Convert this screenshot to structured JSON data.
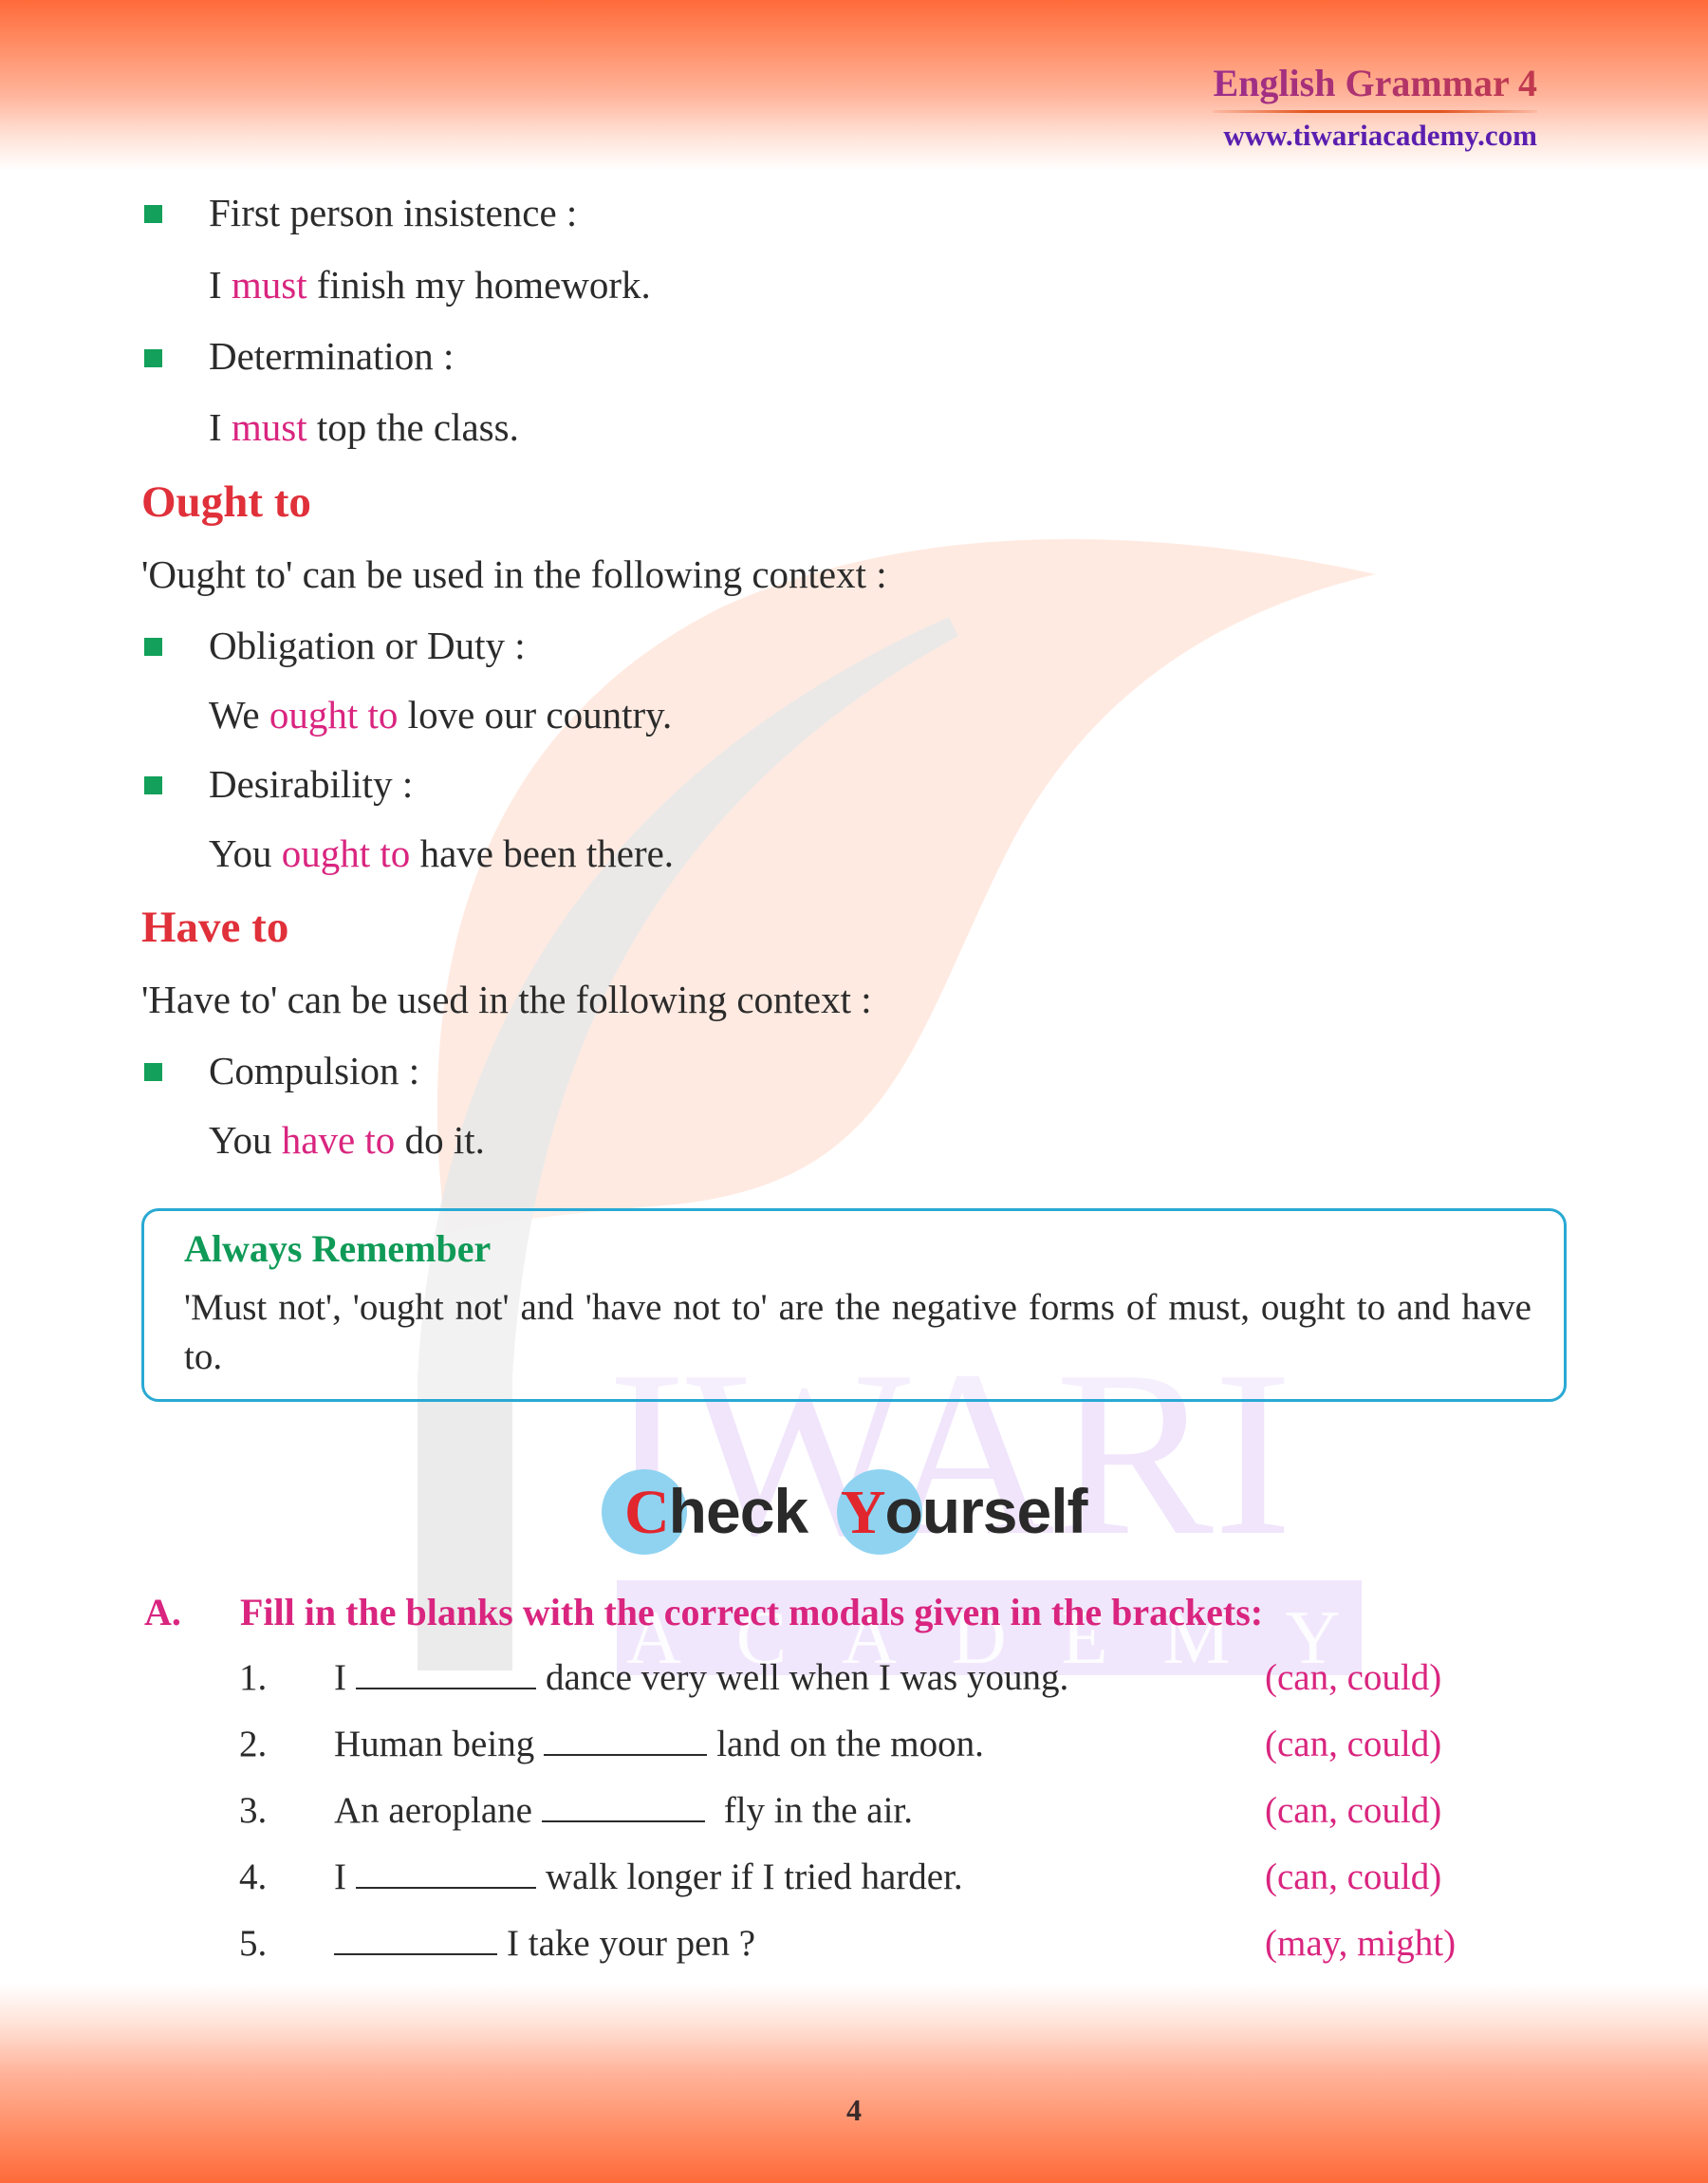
{
  "header": {
    "title": "English Grammar 4",
    "url": "www.tiwariacademy.com"
  },
  "watermark": {
    "main_text": "IWARI",
    "sub_text": "ACADEMY"
  },
  "must_section": {
    "items": [
      {
        "label": "First person insistence :",
        "example": {
          "before": "I ",
          "highlight": "must",
          "after": " finish my homework."
        }
      },
      {
        "label": "Determination :",
        "example": {
          "before": "I ",
          "highlight": "must",
          "after": " top the class."
        }
      }
    ]
  },
  "ought_section": {
    "heading": "Ought to",
    "intro": "'Ought to' can be used in the following context :",
    "items": [
      {
        "label": "Obligation or Duty :",
        "example": {
          "before": "We ",
          "highlight": "ought to",
          "after": " love our country."
        }
      },
      {
        "label": "Desirability :",
        "example": {
          "before": "You ",
          "highlight": "ought to",
          "after": " have been there."
        }
      }
    ]
  },
  "have_section": {
    "heading": "Have to",
    "intro": "'Have to' can be used in the following context :",
    "items": [
      {
        "label": "Compulsion :",
        "example": {
          "before": "You ",
          "highlight": "have to",
          "after": " do it."
        }
      }
    ]
  },
  "always_remember": {
    "title": "Always Remember",
    "text": "'Must not', 'ought not'  and 'have not to' are the negative forms of must, ought to and have to."
  },
  "check_yourself": {
    "word1_cap": "C",
    "word1_rest": "heck",
    "word2_cap": "Y",
    "word2_rest": "ourself"
  },
  "exercise": {
    "letter": "A.",
    "instruction": "Fill in the blanks with the correct modals given in the brackets:",
    "questions": [
      {
        "num": "1.",
        "before": "I",
        "after": "dance very well when I was young.",
        "options": "(can, could)"
      },
      {
        "num": "2.",
        "before": "Human being",
        "after": "land on the moon.",
        "options": "(can, could)"
      },
      {
        "num": "3.",
        "before": "An aeroplane",
        "after": " fly in the air.",
        "options": "(can, could)"
      },
      {
        "num": "4.",
        "before": "I",
        "after": "walk longer if I tried harder.",
        "options": "(can, could)"
      },
      {
        "num": "5.",
        "before": "",
        "after": "I take your pen ?",
        "options": "(may, might)"
      }
    ]
  },
  "colors": {
    "accent_heading": "#e0303a",
    "highlight": "#d9257f",
    "bullet": "#12a05a",
    "remember_border": "#29a9d3",
    "remember_title": "#0f9a57",
    "band": "#ff6a3a"
  },
  "footer": {
    "page_number": "4"
  }
}
